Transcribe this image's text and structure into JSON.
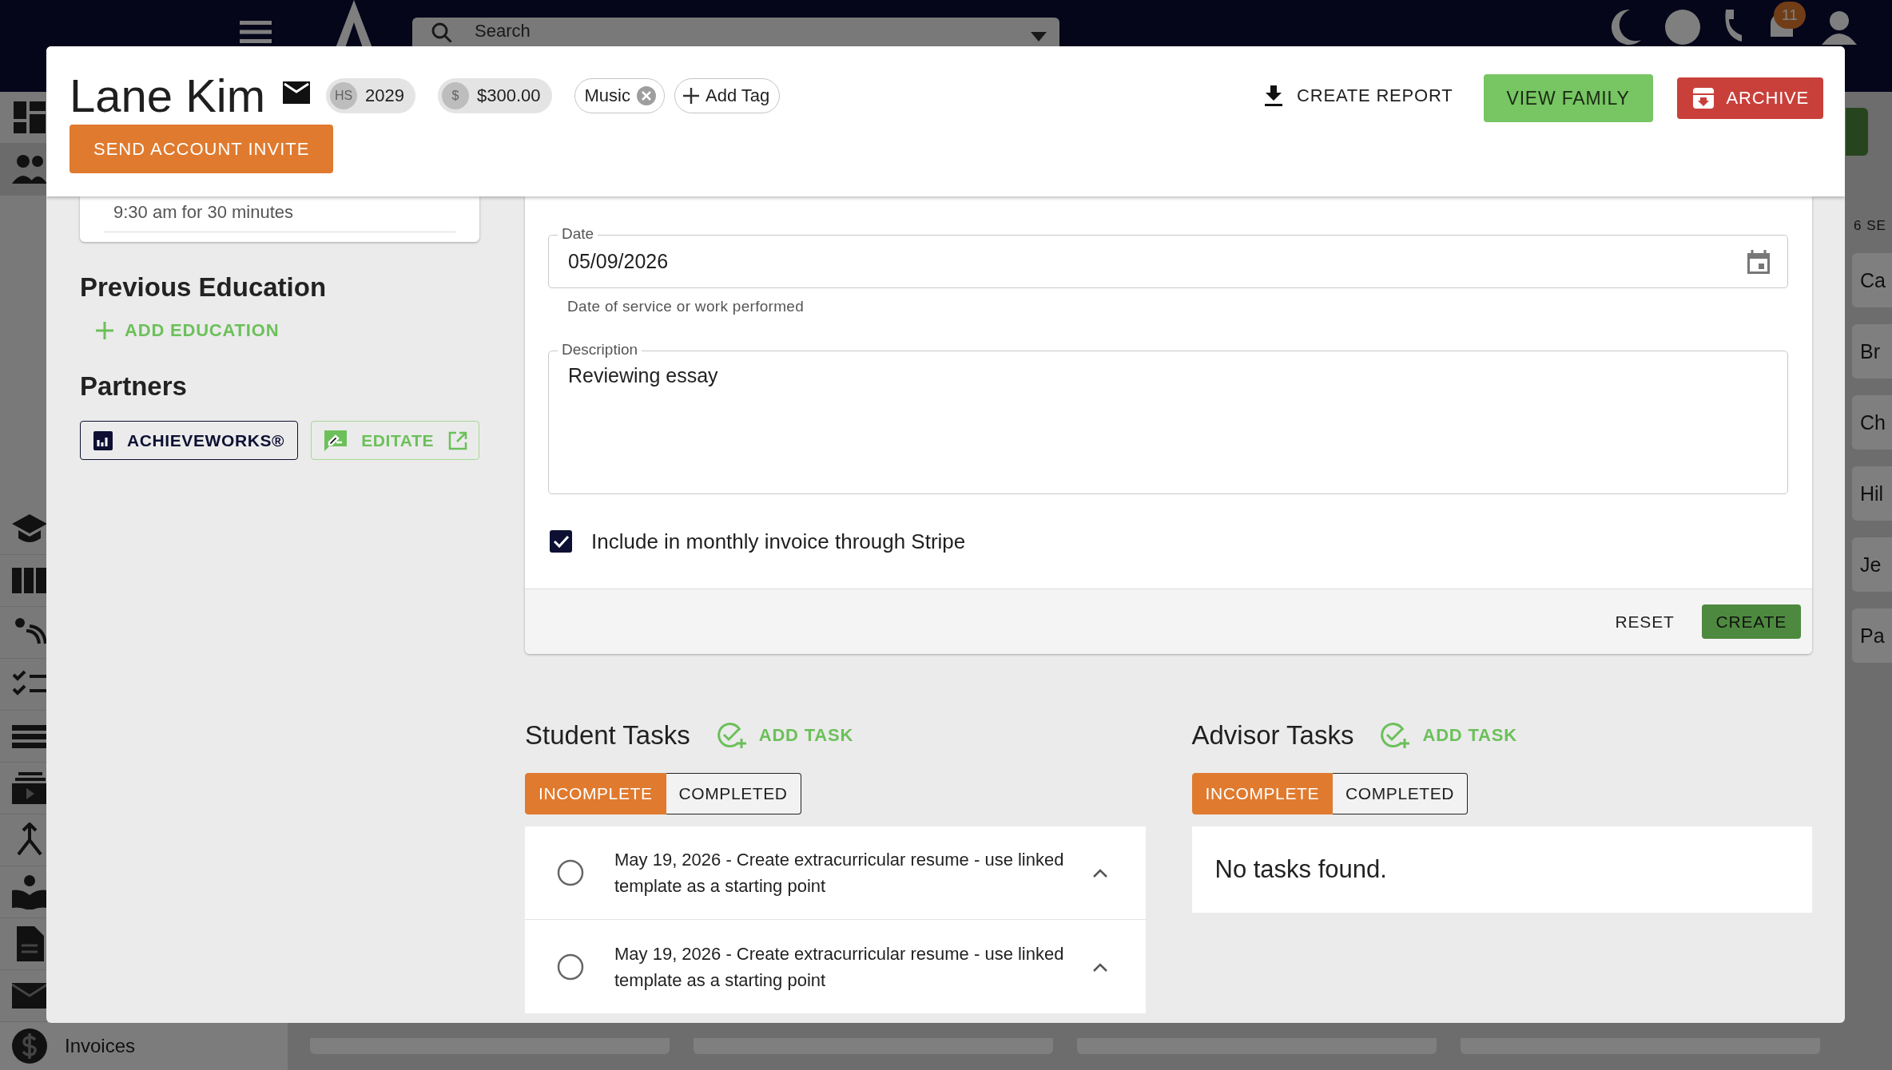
{
  "app": {
    "search": {
      "placeholder": "Search"
    },
    "notification_badge": "11",
    "sidebar": {
      "bottom_item": "Invoices"
    },
    "right_panel": {
      "heading": "6 SE",
      "cards": [
        "Ca",
        "Br",
        "Ch",
        "Hil",
        "Je",
        "Pa"
      ]
    }
  },
  "modal": {
    "header": {
      "name": "Lane Kim",
      "chips": [
        {
          "icon_text": "HS",
          "label": "2029"
        },
        {
          "icon_text": "$",
          "label": "$300.00"
        }
      ],
      "tags": [
        {
          "label": "Music"
        }
      ],
      "add_tag": "Add Tag",
      "invite_button": "SEND ACCOUNT INVITE",
      "actions": [
        {
          "kind": "report",
          "label": "CREATE REPORT"
        },
        {
          "kind": "family",
          "label": "VIEW FAMILY"
        },
        {
          "kind": "archive",
          "label": "ARCHIVE"
        }
      ]
    },
    "sidebar": {
      "meeting_note": "9:30 am for 30 minutes",
      "education": {
        "title": "Previous Education",
        "add": "ADD EDUCATION"
      },
      "partners": {
        "title": "Partners",
        "items": [
          {
            "kind": "achieveworks",
            "label": "ACHIEVEWORKS®"
          },
          {
            "kind": "editate",
            "label": "EDITATE"
          }
        ]
      }
    },
    "form": {
      "date": {
        "label": "Date",
        "value": "05/09/2026",
        "helper": "Date of service or work performed"
      },
      "description": {
        "label": "Description",
        "value": "Reviewing essay"
      },
      "invoice_checkbox": {
        "label": "Include in monthly invoice through Stripe",
        "checked": true
      },
      "buttons": [
        {
          "kind": "text",
          "label": "RESET"
        },
        {
          "kind": "primary",
          "label": "CREATE"
        }
      ]
    },
    "task_panels": [
      {
        "title": "Student Tasks",
        "add": "ADD TASK",
        "tabs": [
          {
            "label": "INCOMPLETE",
            "selected": true
          },
          {
            "label": "COMPLETED",
            "selected": false
          }
        ],
        "tasks": [
          {
            "text": "May 19, 2026 - Create extracurricular resume - use linked template as a starting point",
            "done": false,
            "expanded": true
          },
          {
            "text": "May 19, 2026 - Create extracurricular resume - use linked template as a starting point",
            "done": false,
            "expanded": true
          }
        ]
      },
      {
        "title": "Advisor Tasks",
        "add": "ADD TASK",
        "tabs": [
          {
            "label": "INCOMPLETE",
            "selected": true
          },
          {
            "label": "COMPLETED",
            "selected": false
          }
        ],
        "empty_message": "No tasks found."
      }
    ]
  }
}
